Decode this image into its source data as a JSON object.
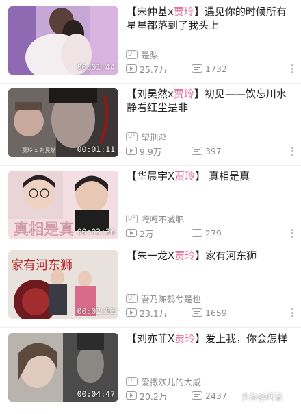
{
  "colors": {
    "accent": "#e76f9d",
    "meta": "#8a8a8a"
  },
  "videos": [
    {
      "title_prefix": "【宋仲基x",
      "title_highlight": "贾玲",
      "title_suffix": "】遇见你的时候所有星星都落到了我头上",
      "uploader": "是梨",
      "views": "25.7万",
      "danmaku": "1732",
      "duration": "00:01:44"
    },
    {
      "title_prefix": "【刘昊然x",
      "title_highlight": "贾玲",
      "title_suffix": "】初见——饮忘川水 静看红尘是非",
      "uploader": "望荆鸿",
      "views": "9.9万",
      "danmaku": "397",
      "duration": "00:01:11",
      "thumb_text": "贾玲 x 刘昊然"
    },
    {
      "title_prefix": "【华晨宇X",
      "title_highlight": "贾玲",
      "title_suffix": "】 真相是真",
      "uploader": "嘎嘎不减肥",
      "views": "2万",
      "danmaku": "279",
      "duration": "00:03:36",
      "thumb_text": "真相是真"
    },
    {
      "title_prefix": "【朱一龙X",
      "title_highlight": "贾玲",
      "title_suffix": "】家有河东狮",
      "uploader": "吾乃陈鹤兮是也",
      "views": "23.1万",
      "danmaku": "1659",
      "duration": "00:02:53",
      "thumb_text": "家有河东狮"
    },
    {
      "title_prefix": "【刘亦菲X",
      "title_highlight": "贾玲",
      "title_suffix": "】爱上我，你会怎样",
      "uploader": "爱撒欢儿的大咸",
      "views": "20.2万",
      "danmaku": "2437",
      "duration": "00:04:47"
    }
  ],
  "up_badge": "UP",
  "watermark": "头条@问答"
}
